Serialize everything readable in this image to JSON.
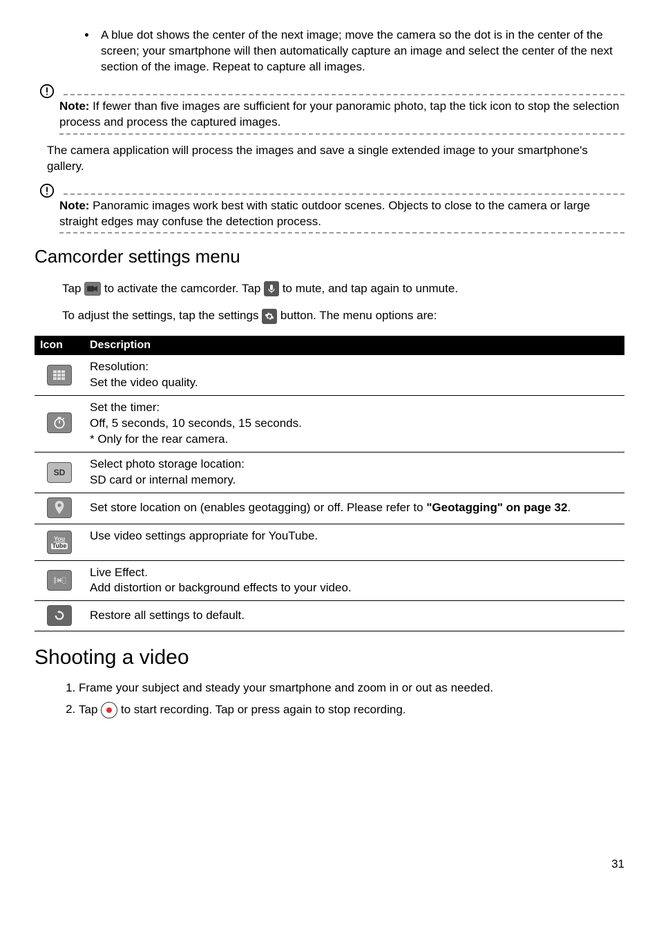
{
  "bullet": "A blue dot shows the center of the next image; move the camera so the dot is in the center of the screen; your smartphone will then automatically capture an image and select the center of the next section of the image. Repeat to capture all images.",
  "note1": {
    "label": "Note:",
    "text": " If fewer than five images are sufficient for your panoramic photo, tap the tick icon to stop the selection process and process the captured images."
  },
  "para1": "The camera application will process the images and save a single extended image to your smartphone's gallery.",
  "note2": {
    "label": "Note:",
    "text": " Panoramic images work best with static outdoor scenes. Objects to close to the camera or large straight edges may confuse the detection process."
  },
  "h2": "Camcorder settings menu",
  "camline": {
    "t1": "Tap ",
    "t2": " to activate the camcorder. Tap ",
    "t3": " to mute, and tap again to unmute."
  },
  "settingsline": {
    "t1": "To adjust the settings, tap the settings ",
    "t2": " button. The menu options are:"
  },
  "table": {
    "h_icon": "Icon",
    "h_desc": "Description",
    "rows": [
      {
        "l1": "Resolution:",
        "l2": "Set the video quality."
      },
      {
        "l1": "Set the timer:",
        "l2": "Off, 5 seconds, 10 seconds, 15 seconds.",
        "l3": "* Only for the rear camera."
      },
      {
        "l1": "Select photo storage location:",
        "l2": "SD card or internal memory."
      },
      {
        "t1": "Set store location on (enables geotagging) or off. Please refer to ",
        "bold": "\"Geotagging\" on page 32",
        "t2": "."
      },
      {
        "l1": "Use video settings appropriate for YouTube."
      },
      {
        "l1": "Live Effect.",
        "l2": "Add distortion or background effects to your video."
      },
      {
        "l1": "Restore all settings to default."
      }
    ]
  },
  "h1": "Shooting a video",
  "steps": {
    "s1": "Frame your subject and steady your smartphone and zoom in or out as needed.",
    "s2a": "Tap ",
    "s2b": " to start recording. Tap or press again to stop recording."
  },
  "page": "31"
}
